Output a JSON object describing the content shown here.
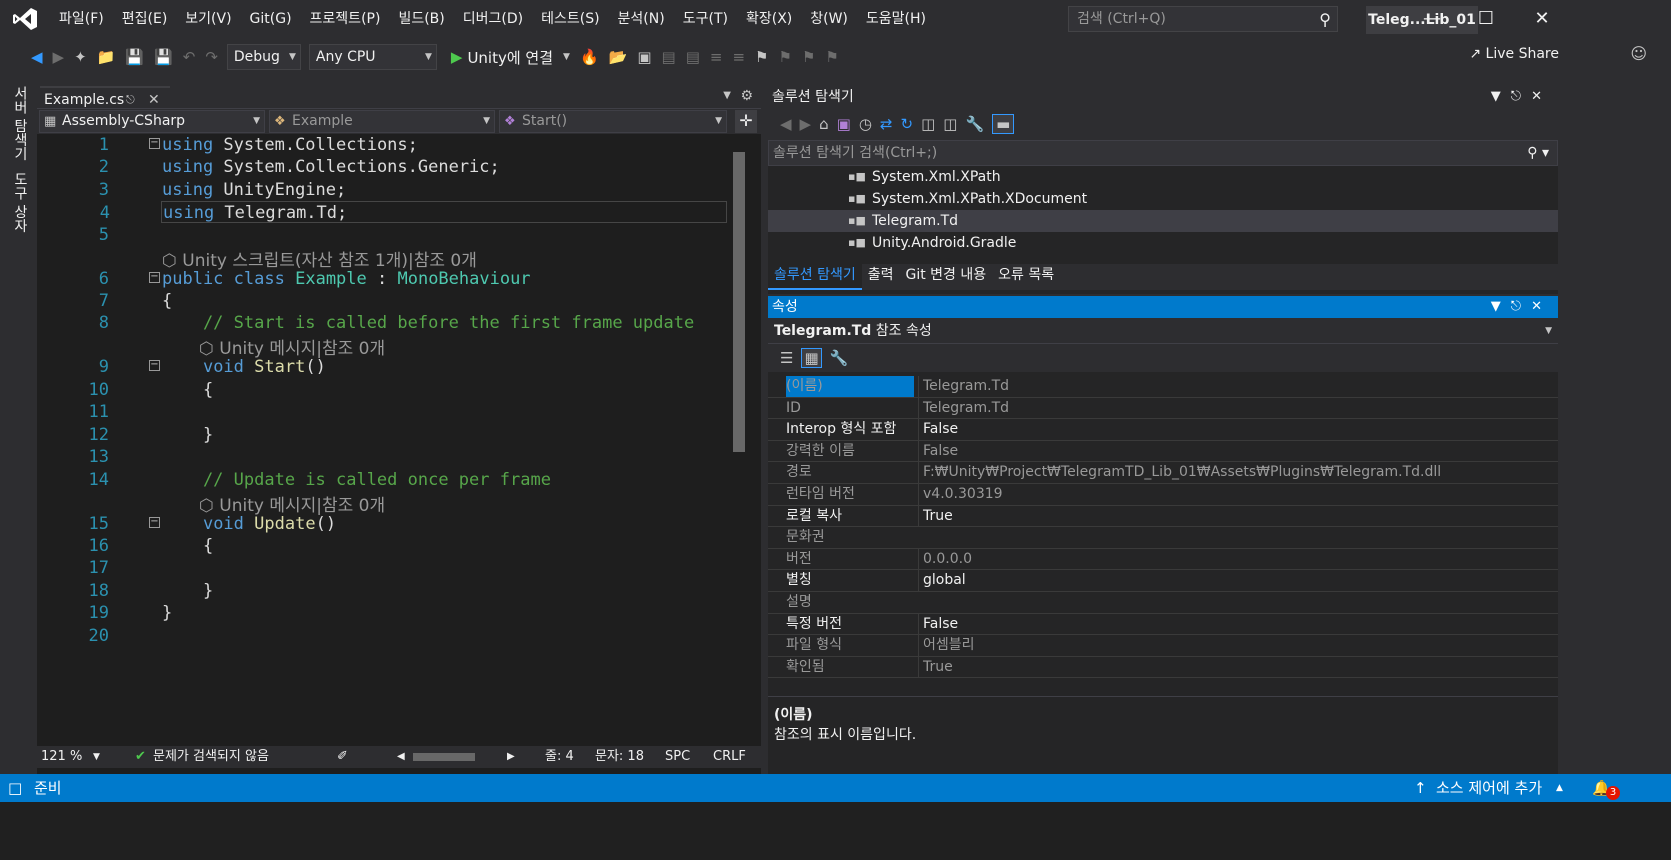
{
  "menu": [
    "파일(F)",
    "편집(E)",
    "보기(V)",
    "Git(G)",
    "프로젝트(P)",
    "빌드(B)",
    "디버그(D)",
    "테스트(S)",
    "분석(N)",
    "도구(T)",
    "확장(X)",
    "창(W)",
    "도움말(H)"
  ],
  "search": {
    "placeholder": "검색 (Ctrl+Q)"
  },
  "window": {
    "title": "Teleg...Lib_01"
  },
  "toolbar": {
    "config": "Debug",
    "platform": "Any CPU",
    "run_label": "Unity에 연결",
    "live_share": "Live Share"
  },
  "side_tabs": [
    "서버 탐색기",
    "도구 상자"
  ],
  "editor": {
    "tab": "Example.cs",
    "nav_project": "Assembly-CSharp",
    "nav_class": "Example",
    "nav_member": "Start()",
    "lines": [
      {
        "n": "1",
        "text": "using System.Collections;"
      },
      {
        "n": "2",
        "text": "using System.Collections.Generic;"
      },
      {
        "n": "3",
        "text": "using UnityEngine;"
      },
      {
        "n": "4",
        "text": "using Telegram.Td;"
      },
      {
        "n": "5",
        "text": ""
      },
      {
        "n": "6",
        "text": "public class Example : MonoBehaviour"
      },
      {
        "n": "7",
        "text": "{"
      },
      {
        "n": "8",
        "text": "    // Start is called before the first frame update"
      },
      {
        "n": "9",
        "text": "    void Start()"
      },
      {
        "n": "10",
        "text": "    {"
      },
      {
        "n": "11",
        "text": ""
      },
      {
        "n": "12",
        "text": "    }"
      },
      {
        "n": "13",
        "text": ""
      },
      {
        "n": "14",
        "text": "    // Update is called once per frame"
      },
      {
        "n": "15",
        "text": "    void Update()"
      },
      {
        "n": "16",
        "text": "    {"
      },
      {
        "n": "17",
        "text": ""
      },
      {
        "n": "18",
        "text": "    }"
      },
      {
        "n": "19",
        "text": "}"
      },
      {
        "n": "20",
        "text": ""
      }
    ],
    "codelens_class": "Unity 스크립트(자산 참조 1개)|참조 0개",
    "codelens_method": "Unity 메시지|참조 0개",
    "zoom": "121 %",
    "issues": "문제가 검색되지 않음",
    "line_pos": "줄: 4",
    "col_pos": "문자: 18",
    "spc": "SPC",
    "crlf": "CRLF"
  },
  "solution": {
    "title": "솔루션 탐색기",
    "search": "솔루션 탐색기 검색(Ctrl+;)",
    "items": [
      "System.Xml.XPath",
      "System.Xml.XPath.XDocument",
      "Telegram.Td",
      "Unity.Android.Gradle"
    ]
  },
  "bottom_tabs": [
    "솔루션 탐색기",
    "출력",
    "Git 변경 내용",
    "오류 목록"
  ],
  "properties": {
    "title": "속성",
    "object_name": "Telegram.Td",
    "object_type": "참조 속성",
    "rows": [
      {
        "name": "(이름)",
        "value": "Telegram.Td",
        "ro": true,
        "sel": true
      },
      {
        "name": "ID",
        "value": "Telegram.Td",
        "ro": true
      },
      {
        "name": "Interop 형식 포함",
        "value": "False",
        "ro": false
      },
      {
        "name": "강력한 이름",
        "value": "False",
        "ro": true
      },
      {
        "name": "경로",
        "value": "F:₩Unity₩Project₩TelegramTD_Lib_01₩Assets₩Plugins₩Telegram.Td.dll",
        "ro": true
      },
      {
        "name": "런타임 버전",
        "value": "v4.0.30319",
        "ro": true
      },
      {
        "name": "로컬 복사",
        "value": "True",
        "ro": false
      },
      {
        "name": "문화권",
        "value": "",
        "ro": true
      },
      {
        "name": "버전",
        "value": "0.0.0.0",
        "ro": true
      },
      {
        "name": "별칭",
        "value": "global",
        "ro": false
      },
      {
        "name": "설명",
        "value": "",
        "ro": true
      },
      {
        "name": "특정 버전",
        "value": "False",
        "ro": false
      },
      {
        "name": "파일 형식",
        "value": "어셈블리",
        "ro": true
      },
      {
        "name": "확인됨",
        "value": "True",
        "ro": true
      }
    ],
    "desc_title": "(이름)",
    "desc_text": "참조의 표시 이름입니다."
  },
  "status": {
    "ready": "준비",
    "source_control": "소스 제어에 추가",
    "notifications": "3"
  },
  "colors": {
    "accent": "#007acc",
    "editor_bg": "#1e1e1e",
    "chrome": "#2d2d30"
  }
}
